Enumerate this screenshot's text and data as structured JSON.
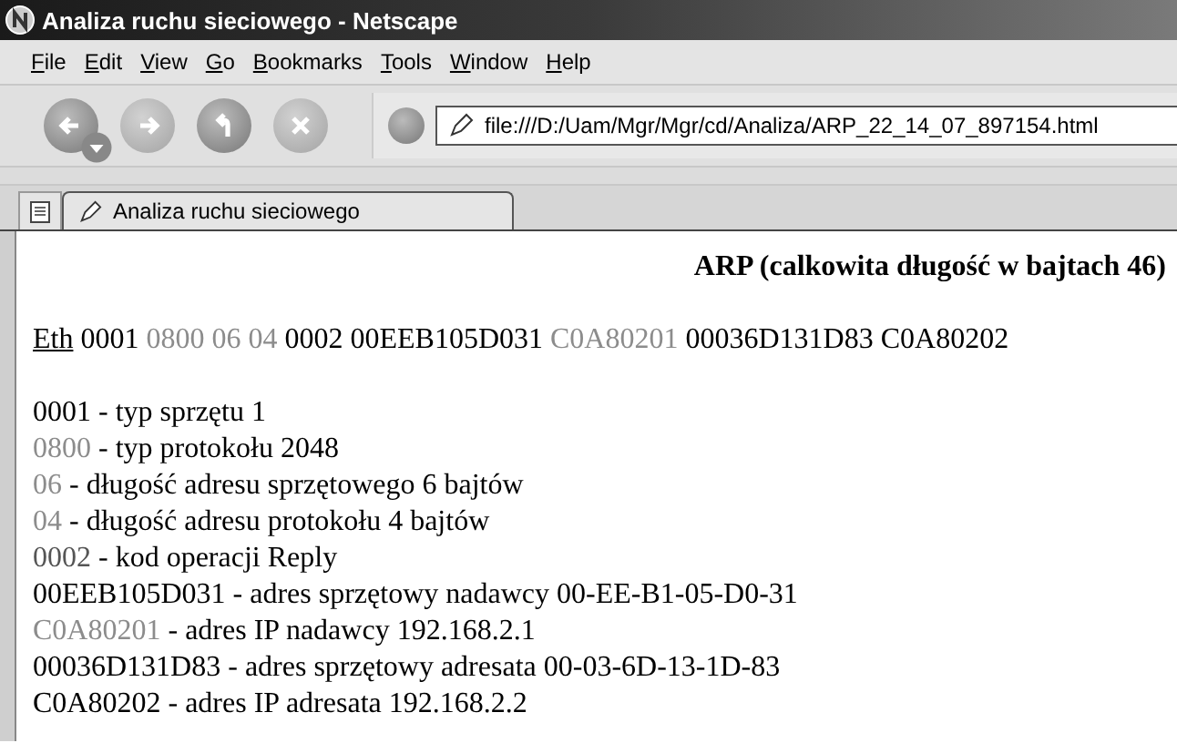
{
  "window": {
    "title": "Analiza ruchu sieciowego - Netscape"
  },
  "menu": [
    {
      "label": "File",
      "access_key_underlined": true
    },
    {
      "label": "Edit",
      "access_key_underlined": true
    },
    {
      "label": "View",
      "access_key_underlined": true
    },
    {
      "label": "Go",
      "access_key_underlined": true
    },
    {
      "label": "Bookmarks",
      "access_key_underlined": true
    },
    {
      "label": "Tools",
      "access_key_underlined": true
    },
    {
      "label": "Window",
      "access_key_underlined": true
    },
    {
      "label": "Help",
      "access_key_underlined": true
    }
  ],
  "toolbar": {
    "buttons": [
      {
        "kind": "back",
        "disabled": false
      },
      {
        "kind": "forward",
        "disabled": true
      },
      {
        "kind": "reload",
        "disabled": false
      },
      {
        "kind": "stop",
        "disabled": true
      }
    ],
    "address": "file:///D:/Uam/Mgr/Mgr/cd/Analiza/ARP_22_14_07_897154.html"
  },
  "tabs": [
    {
      "label": "Analiza ruchu sieciowego",
      "selected": true
    }
  ],
  "page": {
    "heading": "ARP (calkowita długość w bajtach 46)",
    "packet": {
      "link": "Eth",
      "fields": [
        {
          "text": "0001",
          "color": "#000000"
        },
        {
          "text": "0800",
          "color": "#8c8c8c"
        },
        {
          "text": "06",
          "color": "#8c8c8c"
        },
        {
          "text": "04",
          "color": "#8c8c8c"
        },
        {
          "text": "0002",
          "color": "#000000"
        },
        {
          "text": "00EEB105D031",
          "color": "#000000"
        },
        {
          "text": "C0A80201",
          "color": "#8c8c8c"
        },
        {
          "text": "00036D131D83",
          "color": "#000000"
        },
        {
          "text": "C0A80202",
          "color": "#000000"
        }
      ]
    },
    "details": [
      {
        "code": "0001",
        "color": "#000000",
        "text": " - typ sprzętu 1"
      },
      {
        "code": "0800",
        "color": "#8c8c8c",
        "text": " - typ protokołu 2048"
      },
      {
        "code": "06",
        "color": "#8c8c8c",
        "text": " - długość adresu sprzętowego 6 bajtów"
      },
      {
        "code": "04",
        "color": "#8c8c8c",
        "text": " - długość adresu protokołu 4 bajtów"
      },
      {
        "code": "0002",
        "color": "#555555",
        "text": " - kod operacji Reply"
      },
      {
        "code": "00EEB105D031",
        "color": "#000000",
        "text": " - adres sprzętowy nadawcy 00-EE-B1-05-D0-31"
      },
      {
        "code": "C0A80201",
        "color": "#8c8c8c",
        "text": " - adres IP nadawcy 192.168.2.1"
      },
      {
        "code": "00036D131D83",
        "color": "#000000",
        "text": " - adres sprzętowy adresata 00-03-6D-13-1D-83"
      },
      {
        "code": "C0A80202",
        "color": "#000000",
        "text": " - adres IP adresata 192.168.2.2"
      }
    ]
  }
}
